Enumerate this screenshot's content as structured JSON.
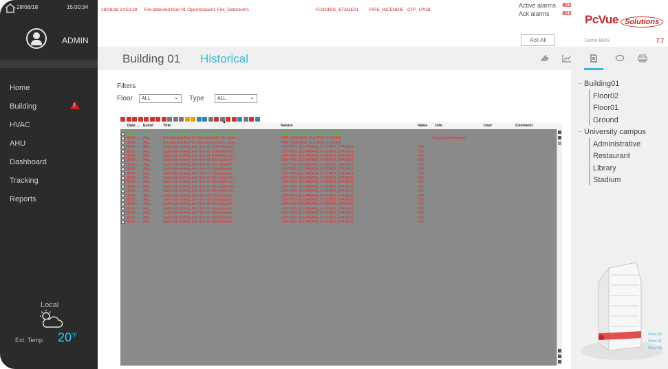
{
  "header": {
    "date": "28/08/18",
    "time": "15:00:34",
    "user": "ADMIN"
  },
  "alarm_banner": {
    "timestamp": "28/08/18  14:53:28",
    "message": "Fire detected floor 01 OpenSpace01 Fire_Detector01",
    "location": "FLOOR01_ETAGE01",
    "nature": "FIRE_INCENDIE",
    "code": "CFP_LPCB",
    "active_label": "Active alarms",
    "active_count": "463",
    "ack_label": "Ack alarms",
    "ack_count": "463",
    "ack_all_label": "Ack All"
  },
  "brand": {
    "logo": "PcVue",
    "logo_suffix": "Solutions",
    "project": "Demo BMS",
    "version": "7.7"
  },
  "page": {
    "title": "Building 01",
    "active_tab": "Historical"
  },
  "toolbar_icons": [
    "alarm-bell-icon",
    "chart-icon",
    "report-icon",
    "comment-icon",
    "print-icon"
  ],
  "nav": {
    "items": [
      {
        "label": "Home"
      },
      {
        "label": "Building"
      },
      {
        "label": "HVAC"
      },
      {
        "label": "AHU"
      },
      {
        "label": "Dashboard"
      },
      {
        "label": "Tracking"
      },
      {
        "label": "Reports"
      }
    ]
  },
  "weather": {
    "location": "Local",
    "temp_label": "Ext. Temp.",
    "temp_value": "20",
    "temp_unit": "°F"
  },
  "filters": {
    "title": "Filters",
    "floor_label": "Floor",
    "floor_value": "ALL",
    "type_label": "Type",
    "type_value": "ALL"
  },
  "grid": {
    "columns": [
      "Date ...",
      "Event",
      "Title",
      "Nature",
      "Value",
      "Info",
      "User",
      "Comment"
    ],
    "rows": [
      {
        "date": "28/08/...",
        "event": "Alar...",
        "title": "Fire detected floor 01 CoffeeRoom01 Fire_Dete...",
        "nature": "FIRE_INCENDIE_FLOOR01_ETAGE01",
        "value": "",
        "info": "",
        "color": "#3fd13f"
      },
      {
        "date": "28/08/...",
        "event": "Alar...",
        "title": "Fire detected floor 01 CoffeeRoom01 Fire_Dete...",
        "nature": "FIRE_INCENDIE_FLOOR01_ETAGE01",
        "value": "",
        "info": "Ongoing Maintenance",
        "color": "#e62b2b"
      },
      {
        "date": "28/08/...",
        "event": "Alar...",
        "title": "Fire detected floor 01 OpenSpace01 Fire_Dete...",
        "nature": "FIRE_INCENDIE_FLOOR01_ETAGE01",
        "value": "",
        "info": "",
        "color": "#e62b2b"
      },
      {
        "date": "28/08/...",
        "event": "Alar...",
        "title": "Light high working time floor 01 CoffeeRoom0...",
        "nature": "LIGHTING_ECLAIRAGE_FLOOR01_ETAGE01",
        "value": "(56)",
        "info": "",
        "color": "#e62b2b"
      },
      {
        "date": "28/08/...",
        "event": "Alar...",
        "title": "Light high working time floor 01 CoffeeRoom0...",
        "nature": "LIGHTING_ECLAIRAGE_FLOOR01_ETAGE01",
        "value": "(56)",
        "info": "",
        "color": "#e62b2b"
      },
      {
        "date": "28/08/...",
        "event": "Alar...",
        "title": "Light high working time floor 01 CoffeeRoom0...",
        "nature": "LIGHTING_ECLAIRAGE_FLOOR01_ETAGE01",
        "value": "(56)",
        "info": "",
        "color": "#e62b2b"
      },
      {
        "date": "28/08/...",
        "event": "Alar...",
        "title": "Light high working time floor 01 OpenSpace0...",
        "nature": "LIGHTING_ECLAIRAGE_FLOOR01_ETAGE01",
        "value": "(56)",
        "info": "",
        "color": "#e62b2b"
      },
      {
        "date": "28/08/...",
        "event": "Alar...",
        "title": "Light high working time floor 01 OpenSpace0...",
        "nature": "LIGHTING_ECLAIRAGE_FLOOR01_ETAGE01",
        "value": "(56)",
        "info": "",
        "color": "#e62b2b"
      },
      {
        "date": "28/08/...",
        "event": "Alar...",
        "title": "Light high working time floor 01 OpenSpace0...",
        "nature": "LIGHTING_ECLAIRAGE_FLOOR01_ETAGE01",
        "value": "(56)",
        "info": "",
        "color": "#e62b2b"
      },
      {
        "date": "28/08/...",
        "event": "Alar...",
        "title": "Light high working time floor 01 OpenSpace0...",
        "nature": "LIGHTING_ECLAIRAGE_FLOOR01_ETAGE01",
        "value": "(56)",
        "info": "",
        "color": "#e62b2b"
      },
      {
        "date": "28/08/...",
        "event": "Alar...",
        "title": "Light high working time floor 01 OpenSpace0...",
        "nature": "LIGHTING_ECLAIRAGE_FLOOR01_ETAGE01",
        "value": "(56)",
        "info": "",
        "color": "#e62b2b"
      },
      {
        "date": "28/08/...",
        "event": "Alar...",
        "title": "Light high working time floor 02 MeetingRoom...",
        "nature": "LIGHTING_ECLAIRAGE_FLOOR02_ETAGE02",
        "value": "(56)",
        "info": "",
        "color": "#e62b2b"
      },
      {
        "date": "28/08/...",
        "event": "Alar...",
        "title": "Light high working time floor 02 MeetingRoom...",
        "nature": "LIGHTING_ECLAIRAGE_FLOOR02_ETAGE02",
        "value": "(56)",
        "info": "",
        "color": "#e62b2b"
      },
      {
        "date": "28/08/...",
        "event": "Alar...",
        "title": "Light high working time floor 02 MeetingRoom...",
        "nature": "LIGHTING_ECLAIRAGE_FLOOR02_ETAGE02",
        "value": "(56)",
        "info": "",
        "color": "#e62b2b"
      },
      {
        "date": "28/08/...",
        "event": "Alar...",
        "title": "Light high working time floor 02 OpenSpace0...",
        "nature": "LIGHTING_ECLAIRAGE_FLOOR02_ETAGE02",
        "value": "(56)",
        "info": "",
        "color": "#e62b2b"
      },
      {
        "date": "28/08/...",
        "event": "Alar...",
        "title": "Light high working time floor 02 OpenSpace0...",
        "nature": "LIGHTING_ECLAIRAGE_FLOOR02_ETAGE02",
        "value": "(56)",
        "info": "",
        "color": "#e62b2b"
      },
      {
        "date": "28/08/...",
        "event": "Alar...",
        "title": "Light high working time floor 02 OpenSpace0...",
        "nature": "LIGHTING_ECLAIRAGE_FLOOR02_ETAGE02",
        "value": "(56)",
        "info": "",
        "color": "#e62b2b"
      },
      {
        "date": "28/08/...",
        "event": "Alar...",
        "title": "Light high working time floor 02 OpenSpace0...",
        "nature": "LIGHTING_ECLAIRAGE_FLOOR02_ETAGE02",
        "value": "(56)",
        "info": "",
        "color": "#e62b2b"
      },
      {
        "date": "28/08/...",
        "event": "Alar...",
        "title": "Light high working time floor 02 OpenSpace0...",
        "nature": "LIGHTING_ECLAIRAGE_FLOOR02_ETAGE02",
        "value": "(56)",
        "info": "",
        "color": "#e62b2b"
      },
      {
        "date": "28/08/...",
        "event": "Alar...",
        "title": "Light high working time floor 02 OpenSpace0...",
        "nature": "LIGHTING_ECLAIRAGE_FLOOR02_ETAGE02",
        "value": "(56)",
        "info": "",
        "color": "#e62b2b"
      },
      {
        "date": "28/08/...",
        "event": "Alar...",
        "title": "Light high working time floor 02 OpenSpace0...",
        "nature": "LIGHTING_ECLAIRAGE_FLOOR02_ETAGE02",
        "value": "(56)",
        "info": "",
        "color": "#e62b2b"
      }
    ]
  },
  "tree": {
    "nodes": [
      {
        "label": "Building01",
        "level": 1
      },
      {
        "label": "Floor02",
        "level": 2
      },
      {
        "label": "Floor01",
        "level": 2
      },
      {
        "label": "Ground",
        "level": 2
      },
      {
        "label": "University campus",
        "level": 1
      },
      {
        "label": "Administrative",
        "level": 2
      },
      {
        "label": "Restaurant",
        "level": 2
      },
      {
        "label": "Library",
        "level": 2
      },
      {
        "label": "Stadium",
        "level": 2
      }
    ]
  },
  "building_view": {
    "floor_labels": [
      "Floor 02",
      "Floor 01",
      "Floor 00"
    ],
    "alarm_badge": "1"
  }
}
